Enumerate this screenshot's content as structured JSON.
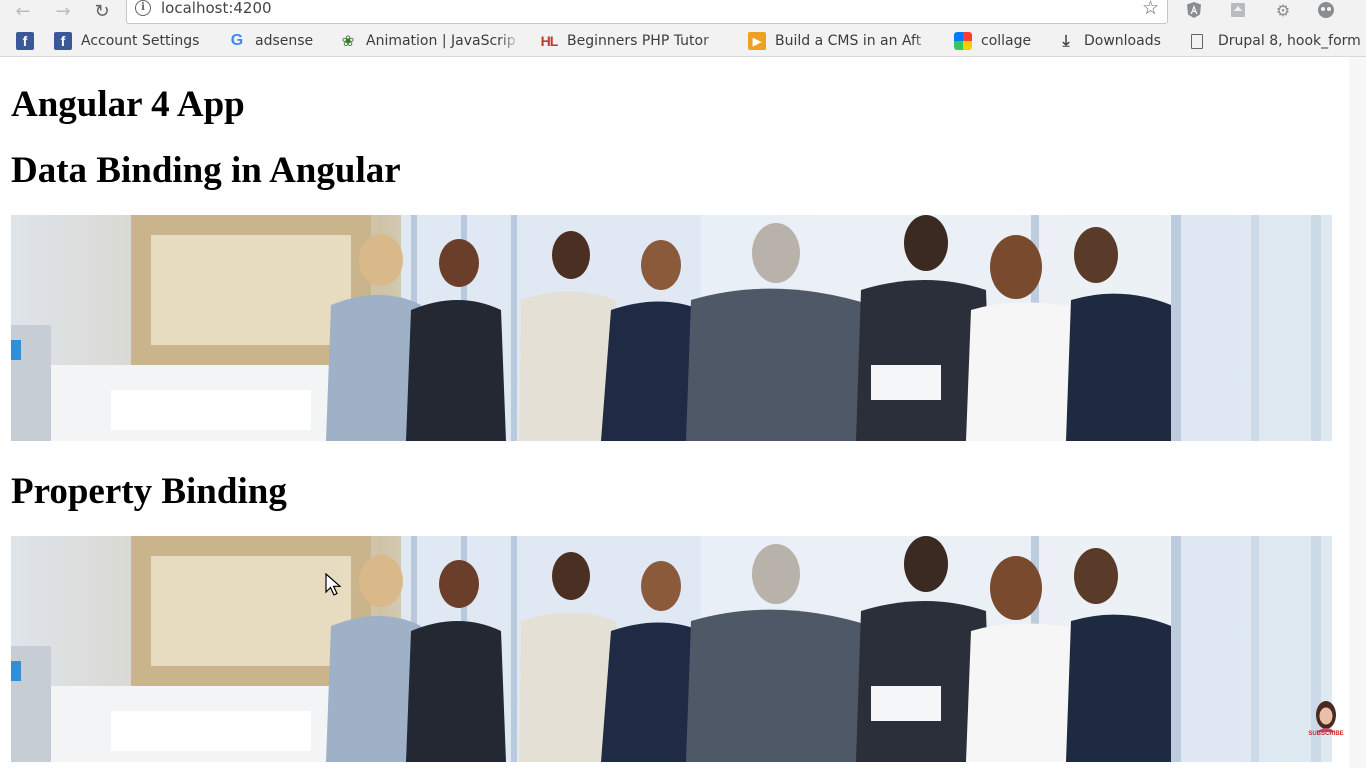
{
  "browser": {
    "url": "localhost:4200",
    "bookmarks": [
      {
        "label": "",
        "icon": "facebook-icon"
      },
      {
        "label": "Account Settings",
        "icon": "facebook-icon"
      },
      {
        "label": "adsense",
        "icon": "google-icon"
      },
      {
        "label": "Animation | JavaScrip",
        "icon": "animation-icon"
      },
      {
        "label": "Beginners PHP Tutor",
        "icon": "hl-icon"
      },
      {
        "label": "Build a CMS in an Aft",
        "icon": "cms-icon"
      },
      {
        "label": "collage",
        "icon": "collage-icon"
      },
      {
        "label": "Downloads",
        "icon": "download-icon"
      },
      {
        "label": "Drupal 8, hook_form",
        "icon": "page-icon"
      }
    ]
  },
  "page": {
    "title": "Angular 4 App",
    "heading_data_binding": "Data Binding in Angular",
    "heading_property_binding": "Property Binding"
  },
  "overlay": {
    "subscribe_label": "SUBSCRIBE"
  },
  "colors": {
    "chrome_bg": "#f2f2f2",
    "facebook_blue": "#3b5998",
    "subscribe_red": "#c62828"
  }
}
